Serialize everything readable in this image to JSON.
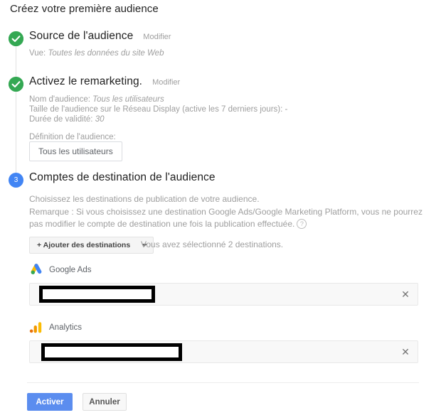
{
  "page": {
    "title": "Créez votre première audience"
  },
  "steps": [
    {
      "marker": "check-icon",
      "title": "Source de l'audience",
      "edit_label": "Modifier",
      "meta_lines": [
        {
          "label": "Vue:",
          "value": "Toutes les données du site Web"
        }
      ]
    },
    {
      "marker": "check-icon",
      "title": "Activez le remarketing.",
      "edit_label": "Modifier",
      "meta_lines": [
        {
          "label": "Nom d'audience:",
          "value": "Tous les utilisateurs"
        },
        {
          "label": "Taille de l'audience sur le Réseau Display (active les 7 derniers jours):",
          "value": "-"
        },
        {
          "label": "Durée de validité:",
          "value": "30"
        }
      ],
      "definition_label": "Définition de l'audience:",
      "definition_chip": "Tous les utilisateurs"
    },
    {
      "marker": "3",
      "title": "Comptes de destination de l'audience",
      "description_line_1": "Choisissez les destinations de publication de votre audience.",
      "description_line_2": "Remarque : Si vous choisissez une destination Google Ads/Google Marketing Platform, vous ne pourrez pas modifier le compte de destination une fois la publication effectuée.",
      "help_icon": "help-circle-icon"
    }
  ],
  "destinations_toolbar": {
    "add_button_label": "+ Ajouter des destinations",
    "caret_icon": "chevron-down-icon",
    "selection_status": "Vous avez sélectionné 2 destinations."
  },
  "destinations": [
    {
      "logo": "google-ads-logo",
      "label": "Google Ads",
      "account_value": "",
      "redacted": true,
      "close_icon": "close-icon"
    },
    {
      "logo": "google-analytics-logo",
      "label": "Analytics",
      "account_value": "",
      "redacted": true,
      "close_icon": "close-icon"
    }
  ],
  "footer": {
    "primary_label": "Activer",
    "secondary_label": "Annuler"
  },
  "colors": {
    "step_done": "#34a853",
    "step_active": "#4285f4",
    "primary_button": "#5b8def",
    "muted_text": "#9e9e9e"
  }
}
